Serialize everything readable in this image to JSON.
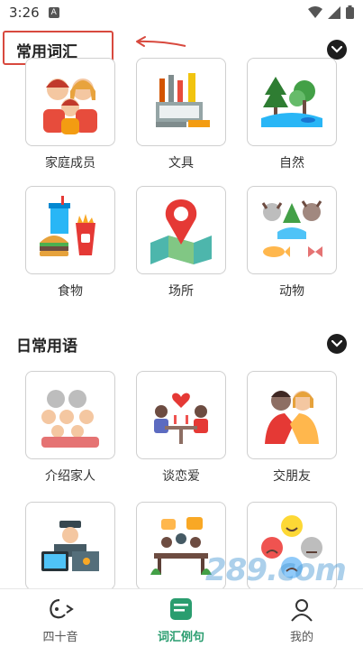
{
  "status_bar": {
    "time": "3:26",
    "a_badge": "A"
  },
  "sections": [
    {
      "title": "常用词汇",
      "items": [
        {
          "label": "家庭成员",
          "icon": "family-icon"
        },
        {
          "label": "文具",
          "icon": "stationery-icon"
        },
        {
          "label": "自然",
          "icon": "nature-icon"
        },
        {
          "label": "食物",
          "icon": "food-icon"
        },
        {
          "label": "场所",
          "icon": "location-pin-map-icon"
        },
        {
          "label": "动物",
          "icon": "animals-icon"
        }
      ]
    },
    {
      "title": "日常用语",
      "items": [
        {
          "label": "介绍家人",
          "icon": "introduce-family-icon"
        },
        {
          "label": "谈恋爱",
          "icon": "dating-couple-icon"
        },
        {
          "label": "交朋友",
          "icon": "make-friends-icon"
        },
        {
          "label": "",
          "icon": "police-officer-icon"
        },
        {
          "label": "",
          "icon": "meeting-table-icon"
        },
        {
          "label": "",
          "icon": "emotion-faces-icon"
        }
      ]
    }
  ],
  "bottom_nav": [
    {
      "label": "四十音",
      "icon": "kana-icon",
      "active": false
    },
    {
      "label": "词汇例句",
      "icon": "vocabulary-icon",
      "active": true
    },
    {
      "label": "我的",
      "icon": "profile-icon",
      "active": false
    }
  ],
  "watermark": "289.com 手游网",
  "colors": {
    "accent": "#2a9d6f",
    "highlight": "#d8493e",
    "toggle": "#1e1e1e"
  }
}
